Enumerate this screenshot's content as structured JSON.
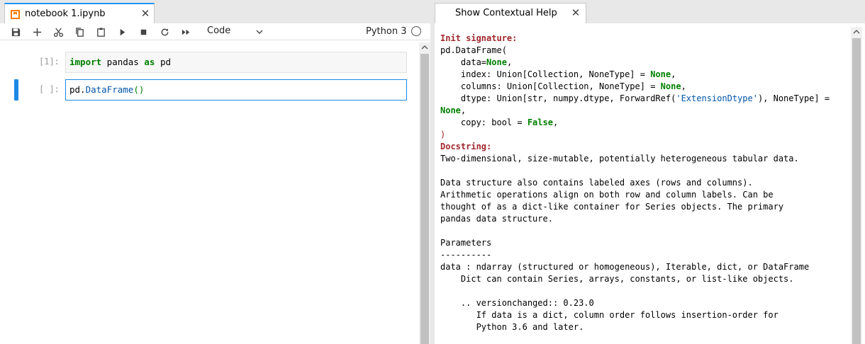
{
  "notebook": {
    "tab": {
      "title": "notebook 1.ipynb",
      "close": "✕"
    },
    "toolbar": {
      "buttons": [
        "save",
        "insert-cell",
        "cut",
        "copy",
        "paste",
        "run",
        "stop",
        "restart",
        "run-all"
      ],
      "cell_type": "Code",
      "kernel_name": "Python 3"
    },
    "cells": [
      {
        "prompt": "[1]:",
        "code_kw1": "import",
        "code_mid": " pandas ",
        "code_kw2": "as",
        "code_end": " pd"
      },
      {
        "prompt": "[ ]:",
        "code_prefix": "pd.",
        "code_attr": "DataFrame",
        "code_paren": "()"
      }
    ]
  },
  "help": {
    "tab": {
      "title": "Show Contextual Help",
      "close": "✕"
    },
    "sig_head": "Init signature:",
    "sig_l1": "pd.DataFrame(",
    "sig_l2_a": "    data=",
    "sig_l2_b": "None",
    "sig_l2_c": ",",
    "sig_l3_a": "    index: Union[Collection, NoneType] = ",
    "sig_l3_b": "None",
    "sig_l3_c": ",",
    "sig_l4_a": "    columns: Union[Collection, NoneType] = ",
    "sig_l4_b": "None",
    "sig_l4_c": ",",
    "sig_l5_a": "    dtype: Union[str, numpy.dtype, ForwardRef(",
    "sig_l5_b": "'ExtensionDtype'",
    "sig_l5_c": "), NoneType] =",
    "sig_l6_a": "None",
    "sig_l6_b": ",",
    "sig_l7_a": "    copy: bool = ",
    "sig_l7_b": "False",
    "sig_l7_c": ",",
    "sig_l8": ")",
    "doc_head": "Docstring:",
    "doc_text": "Two-dimensional, size-mutable, potentially heterogeneous tabular data.\n\nData structure also contains labeled axes (rows and columns).\nArithmetic operations align on both row and column labels. Can be\nthought of as a dict-like container for Series objects. The primary\npandas data structure.\n\nParameters\n----------\ndata : ndarray (structured or homogeneous), Iterable, dict, or DataFrame\n    Dict can contain Series, arrays, constants, or list-like objects.\n\n    .. versionchanged:: 0.23.0\n       If data is a dict, column order follows insertion-order for\n       Python 3.6 and later."
  }
}
